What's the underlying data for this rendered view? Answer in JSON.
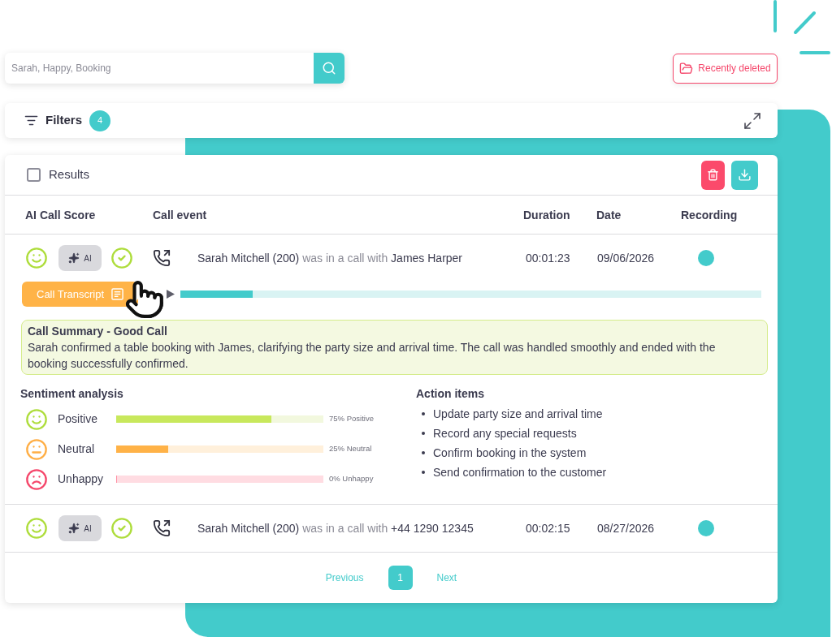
{
  "search": {
    "placeholder": "Sarah, Happy, Booking"
  },
  "recently_deleted": {
    "label": "Recently deleted"
  },
  "filters": {
    "label": "Filters",
    "count": "4"
  },
  "results": {
    "label": "Results",
    "select_all_checked": false,
    "columns": [
      "AI Call Score",
      "Call event",
      "Duration",
      "Date",
      "Recording"
    ],
    "rows": [
      {
        "score": {
          "kind": "positive"
        },
        "ai_label": "AI",
        "caller": "Sarah Mitchell (200)",
        "action": "was in a call with",
        "callee": "James Harper",
        "duration": "00:01:23",
        "date": "09/06/2026",
        "recording": true,
        "expanded": true,
        "details": {
          "transcript_button": "Call Transcript",
          "playback": {
            "level": 0.125
          },
          "summary": {
            "title": "Call Summary - Good Call",
            "text": "Sarah confirmed a table booking with James, clarifying the party size and arrival time. The call was handled smoothly and ended with the booking successfully confirmed."
          },
          "sentiment_analysis": {
            "title": "Sentiment analysis",
            "items": [
              {
                "kind": "positive",
                "label": "Positive",
                "level": 0.75,
                "reading": "75% Positive"
              },
              {
                "kind": "neutral",
                "label": "Neutral",
                "level": 0.25,
                "reading": "25% Neutral"
              },
              {
                "kind": "unhappy",
                "label": "Unhappy",
                "level": 0,
                "reading": "0% Unhappy"
              }
            ]
          },
          "action_items": {
            "title": "Action items",
            "items": [
              "Update party size and arrival time",
              "Record any special requests",
              "Confirm booking in the system",
              "Send confirmation to the customer"
            ]
          }
        }
      },
      {
        "score": {
          "kind": "positive"
        },
        "ai_label": "AI",
        "caller": "Sarah Mitchell (200)",
        "action": "was in a call with",
        "callee": "+44 1290 12345",
        "duration": "00:02:15",
        "date": "08/27/2026",
        "recording": true,
        "expanded": false
      }
    ]
  },
  "pagination": {
    "previous": "Previous",
    "pages": [
      {
        "label": "1",
        "selected": true
      }
    ],
    "next": "Next"
  }
}
